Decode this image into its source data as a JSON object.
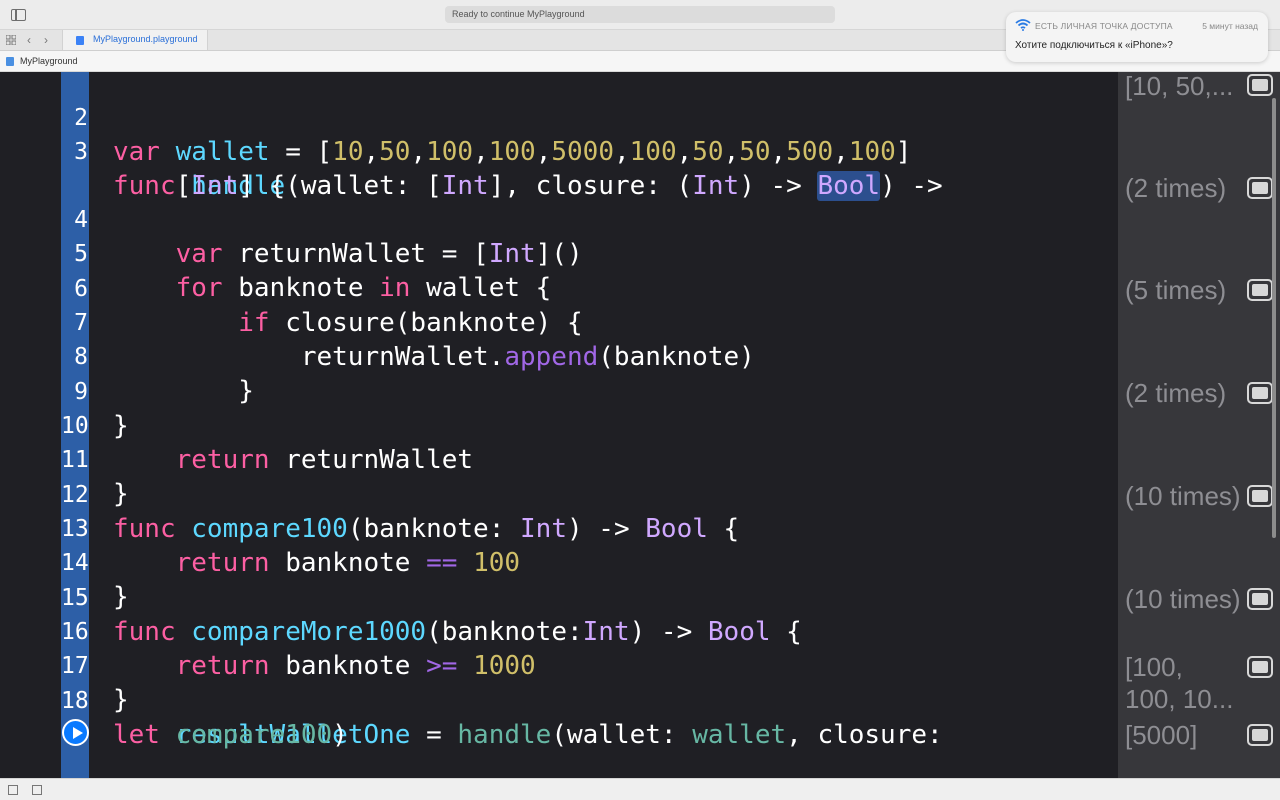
{
  "titlebar": {
    "activity_status": "Ready to continue MyPlayground"
  },
  "notification": {
    "title": "ЕСТЬ ЛИЧНАЯ ТОЧКА ДОСТУПА",
    "time": "5 минут назад",
    "body": "Хотите подключиться к «iPhone»?"
  },
  "tabbar": {
    "tab_label": "MyPlayground.playground",
    "back": "‹",
    "forward": "›"
  },
  "jumpbar": {
    "label": "MyPlayground"
  },
  "editor": {
    "line_numbers": [
      "2",
      "3",
      "4",
      "5",
      "6",
      "7",
      "8",
      "9",
      "10",
      "11",
      "12",
      "13",
      "14",
      "15",
      "16",
      "17",
      "18"
    ],
    "colors": {
      "keyword": "#fc5fa3",
      "type": "#d0a8ff",
      "function": "#5dd8ff",
      "variable": "#67b7a4",
      "number": "#d0bf69",
      "gutter": "#2d5fa7"
    }
  },
  "results": [
    "[10, 50,...",
    "(2 times)",
    "(5 times)",
    "(2 times)",
    "(10 times)",
    "(10 times)",
    "[100,",
    "100, 10...",
    "[5000]"
  ]
}
